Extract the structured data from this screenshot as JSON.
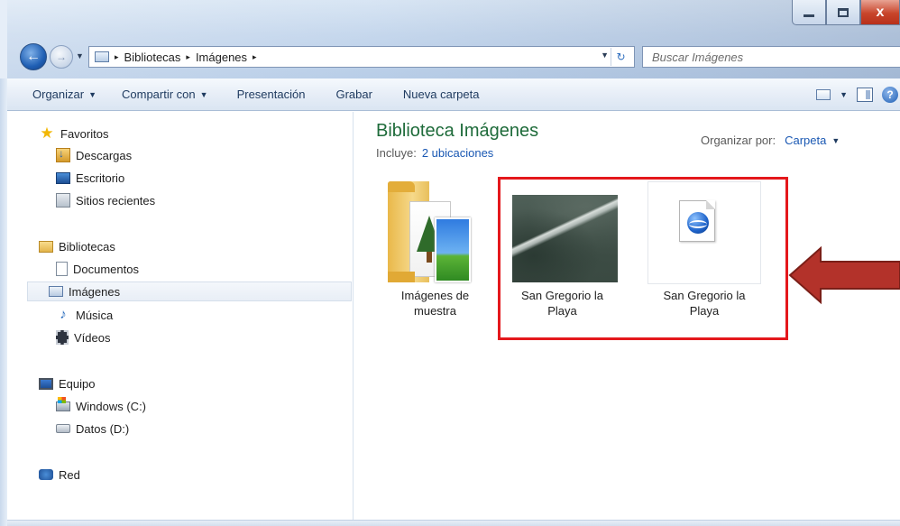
{
  "window": {
    "controls": [
      "minimize-icon",
      "maximize-icon",
      "close-icon"
    ],
    "close_glyph": "x"
  },
  "nav": {
    "back_glyph": "←",
    "forward_glyph": "→",
    "history_glyph": "▼"
  },
  "address": {
    "crumbs": [
      "Bibliotecas",
      "Imágenes"
    ],
    "separator": "▸",
    "dropdown_glyph": "▼",
    "refresh_glyph": "↻"
  },
  "search": {
    "placeholder": "Buscar Imágenes"
  },
  "toolbar": {
    "organize": "Organizar",
    "share": "Compartir con",
    "slideshow": "Presentación",
    "burn": "Grabar",
    "new_folder": "Nueva carpeta",
    "dropdown_glyph": "▼",
    "help_glyph": "?"
  },
  "sidebar": {
    "favorites": {
      "label": "Favoritos",
      "items": [
        "Descargas",
        "Escritorio",
        "Sitios recientes"
      ]
    },
    "libraries": {
      "label": "Bibliotecas",
      "items": [
        "Documentos",
        "Imágenes",
        "Música",
        "Vídeos"
      ],
      "selected": "Imágenes"
    },
    "computer": {
      "label": "Equipo",
      "items": [
        "Windows  (C:)",
        "Datos (D:)"
      ]
    },
    "network": {
      "label": "Red"
    }
  },
  "content": {
    "title": "Biblioteca Imágenes",
    "includes_label": "Incluye:",
    "includes_link": "2 ubicaciones",
    "arrange_label": "Organizar por:",
    "arrange_value": "Carpeta",
    "items": [
      {
        "label_line1": "Imágenes de",
        "label_line2": "muestra",
        "kind": "folder"
      },
      {
        "label_line1": "San Gregorio la",
        "label_line2": "Playa",
        "kind": "image"
      },
      {
        "label_line1": "San Gregorio la",
        "label_line2": "Playa",
        "kind": "kml"
      }
    ]
  },
  "annotation": {
    "highlight_color": "#e4181c",
    "arrow_color": "#b3322a"
  },
  "colors": {
    "title_green": "#1e6b3a",
    "link_blue": "#1a58b3",
    "toolbar_text": "#1e3a5f"
  }
}
